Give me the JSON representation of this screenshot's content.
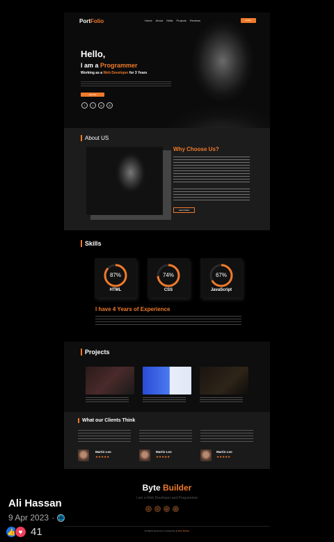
{
  "nav": {
    "logo_a": "Port",
    "logo_b": "Folio",
    "links": [
      "Home",
      "About",
      "Skills",
      "Projects",
      "Reviews"
    ],
    "follow": "Follow"
  },
  "hero": {
    "hello": "Hello,",
    "iam_prefix": "I am a ",
    "iam_role": "Programmer",
    "working_a": "Working as a ",
    "working_b": "Web Developer",
    "working_c": " for 3 Years",
    "hire": "Hire Me",
    "social_icons": [
      "facebook-icon",
      "twitter-icon",
      "linkedin-icon",
      "instagram-icon"
    ]
  },
  "about": {
    "title": "About US",
    "why": "Why Choose Us?",
    "learn_more": "Learn More"
  },
  "skills": {
    "title": "Skills",
    "items": [
      {
        "percent": 87,
        "pct_label": "87%",
        "name": "HTML"
      },
      {
        "percent": 74,
        "pct_label": "74%",
        "name": "CSS"
      },
      {
        "percent": 67,
        "pct_label": "67%",
        "name": "JavaScript"
      }
    ],
    "experience": "I have 4 Years of Experience"
  },
  "projects": {
    "title": "Projects"
  },
  "clients": {
    "title": "What our Clients Think",
    "items": [
      {
        "name": "Martin Leo",
        "stars": "★★★★★"
      },
      {
        "name": "Martin Leo",
        "stars": "★★★★★"
      },
      {
        "name": "Martin Leo",
        "stars": "★★★★★"
      }
    ]
  },
  "footer": {
    "brand_a": "Byte",
    "brand_b": "Builder",
    "subtitle": "I am a Web Developer and Programmer",
    "copyright_a": "All Rights Reserved | Created By @ ",
    "copyright_b": "Byte Builder"
  },
  "post": {
    "author": "Ali Hassan",
    "date": "9 Apr 2023",
    "separator": "·",
    "reactions_count": "41"
  },
  "colors": {
    "accent": "#f07a2a",
    "like": "#1b74e4",
    "love": "#f33e58"
  }
}
